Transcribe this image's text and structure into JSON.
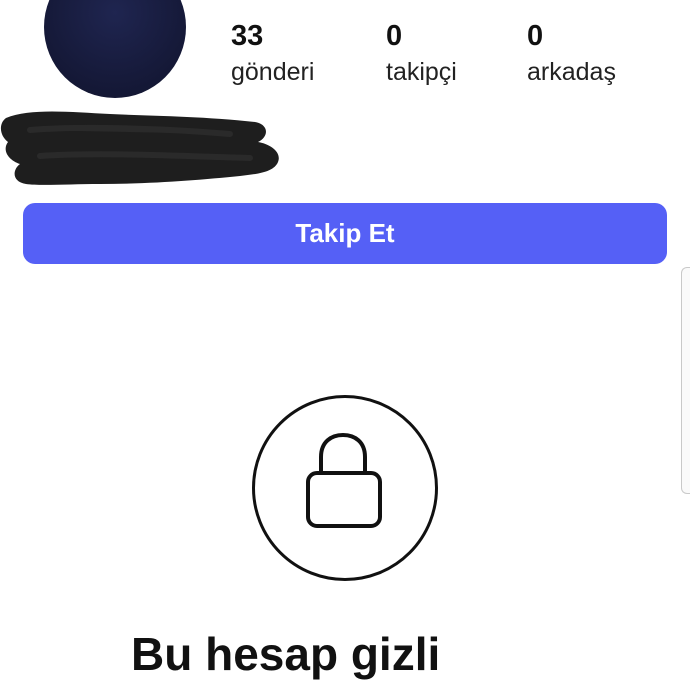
{
  "profile": {
    "stats": {
      "posts": {
        "count": "33",
        "label": "gönderi"
      },
      "followers": {
        "count": "0",
        "label": "takipçi"
      },
      "friends": {
        "count": "0",
        "label": "arkadaş"
      }
    },
    "follow_button_label": "Takip Et"
  },
  "private_account": {
    "icon": "lock-icon",
    "title": "Bu hesap gizli"
  },
  "colors": {
    "accent": "#5560f6",
    "avatar": "#161a3a",
    "redaction": "#1e1e1e"
  }
}
